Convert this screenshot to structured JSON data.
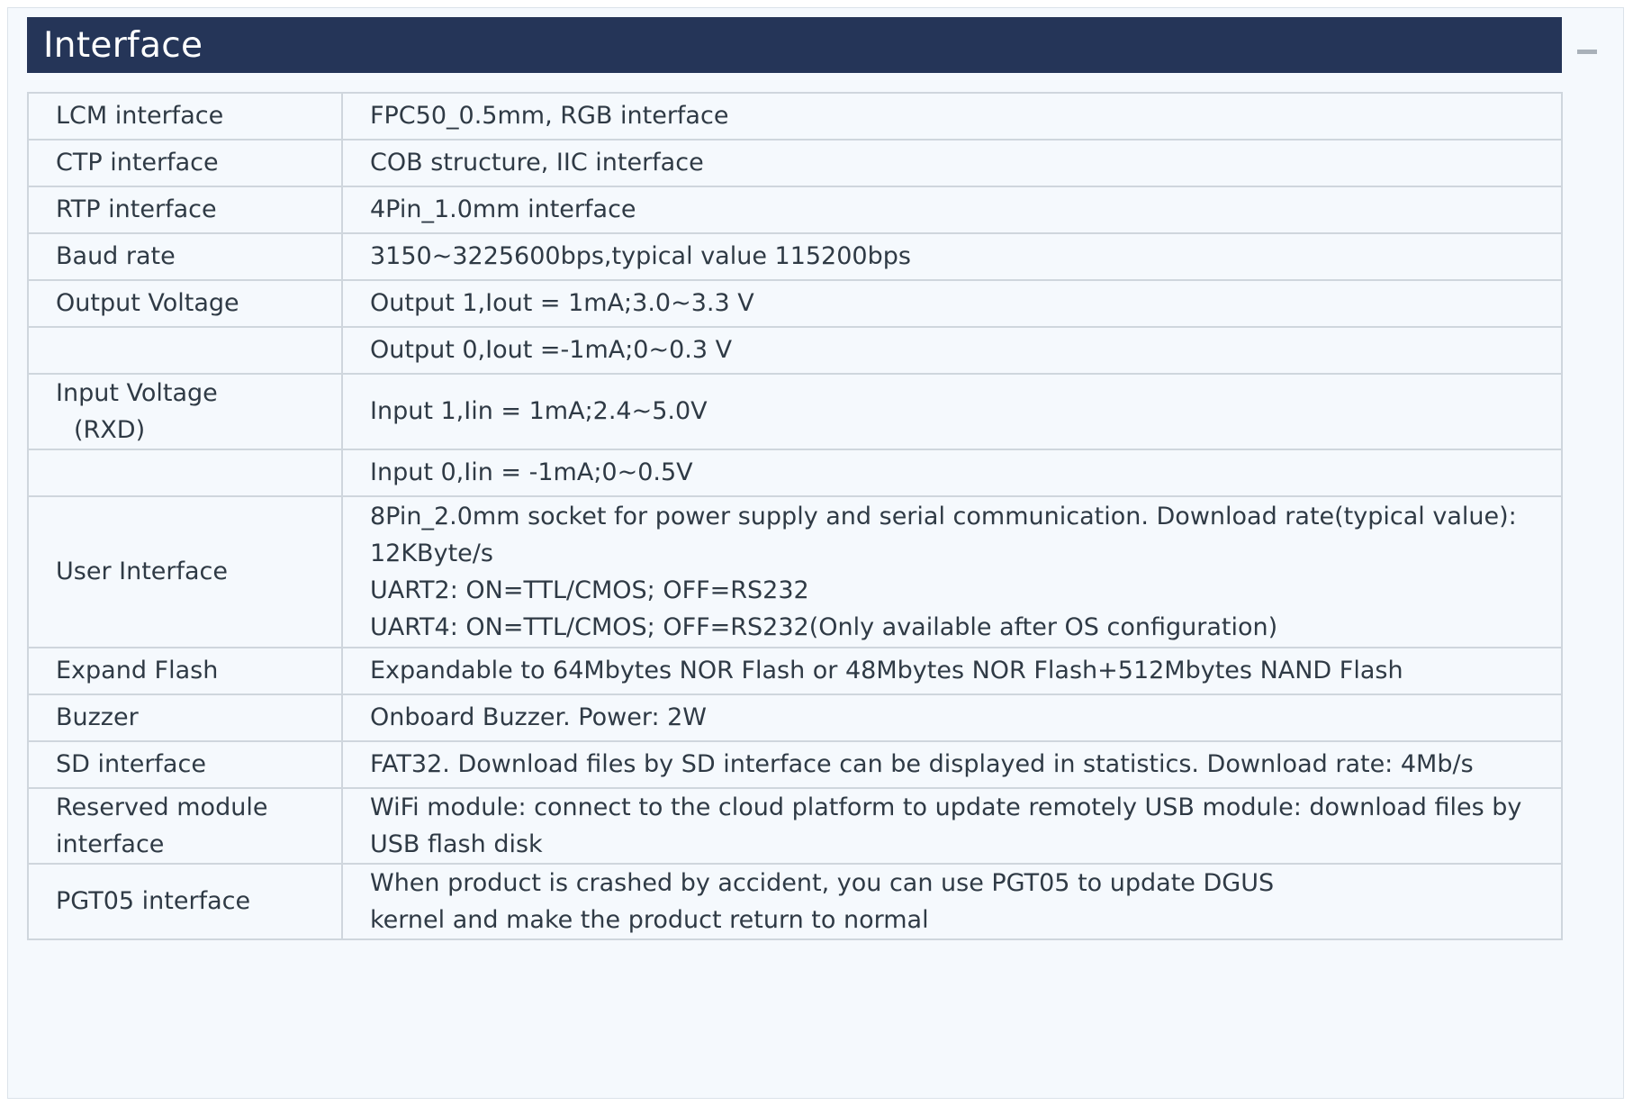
{
  "header": {
    "title": "Interface"
  },
  "rows": [
    {
      "label": "LCM interface",
      "value": "FPC50_0.5mm, RGB interface"
    },
    {
      "label": "CTP interface",
      "value": "COB structure, IIC interface"
    },
    {
      "label": "RTP interface",
      "value": "4Pin_1.0mm interface"
    },
    {
      "label": "Baud rate",
      "value": "3150~3225600bps,typical value 115200bps"
    },
    {
      "label": "Output Voltage",
      "value": "Output 1,Iout = 1mA;3.0~3.3 V"
    },
    {
      "label": "",
      "value": "Output 0,Iout =-1mA;0~0.3 V"
    },
    {
      "label": "Input Voltage",
      "label_sub": "(RXD)",
      "value": "Input 1,Iin = 1mA;2.4~5.0V"
    },
    {
      "label": "",
      "value": "Input 0,Iin = -1mA;0~0.5V"
    },
    {
      "label": "User Interface",
      "lines": [
        "8Pin_2.0mm socket for power supply and serial communication. Download rate(typical value):",
        "12KByte/s",
        "UART2: ON=TTL/CMOS; OFF=RS232",
        "UART4: ON=TTL/CMOS; OFF=RS232(Only available after OS configuration)"
      ]
    },
    {
      "label": "Expand Flash",
      "value": "Expandable to 64Mbytes NOR Flash or 48Mbytes NOR Flash+512Mbytes NAND Flash"
    },
    {
      "label": "Buzzer",
      "value": "Onboard Buzzer. Power: 2W"
    },
    {
      "label": "SD interface",
      "value": "FAT32. Download files by SD interface can be displayed in statistics. Download rate: 4Mb/s"
    },
    {
      "label_lines": [
        "Reserved module",
        "interface"
      ],
      "lines": [
        "WiFi module: connect to the cloud platform to update remotely USB module: download files by",
        "USB flash disk"
      ]
    },
    {
      "label": "PGT05 interface",
      "lines": [
        "When product is crashed by accident, you can use PGT05 to update DGUS",
        "kernel and make the product return to normal"
      ]
    }
  ],
  "icons": {
    "collapse": "minus-icon"
  }
}
